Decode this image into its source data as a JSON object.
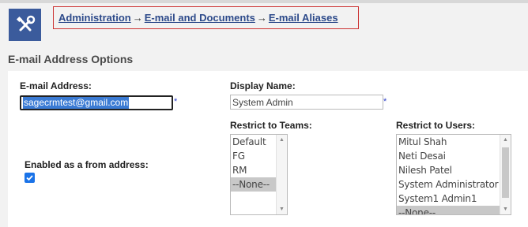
{
  "breadcrumb": {
    "items": [
      "Administration",
      "E-mail and Documents",
      "E-mail Aliases"
    ],
    "separator": "→"
  },
  "section": {
    "title": "E-mail Address Options"
  },
  "form": {
    "email": {
      "label": "E-mail Address:",
      "value": "sagecrmtest@gmail.com",
      "required_marker": "*"
    },
    "display_name": {
      "label": "Display Name:",
      "value": "System Admin",
      "required_marker": "*"
    },
    "enabled": {
      "label": "Enabled as a from address:",
      "checked": true
    },
    "teams": {
      "label": "Restrict to Teams:",
      "options": [
        "Default",
        "FG",
        "RM",
        "--None--"
      ],
      "selected": "--None--"
    },
    "users": {
      "label": "Restrict to Users:",
      "options": [
        "Mitul Shah",
        "Neti Desai",
        "Nilesh Patel",
        "System Administrator",
        "System1 Admin1",
        "--None--"
      ],
      "selected": "--None--"
    }
  },
  "colors": {
    "accent": "#3b5b9c",
    "link": "#2d4a8a",
    "highlight_border": "#cc3333",
    "checkbox": "#1a73e8"
  },
  "icons": {
    "app": "tools-icon",
    "check": "check-icon",
    "scroll_up": "arrow-up-icon",
    "scroll_down": "arrow-down-icon"
  }
}
